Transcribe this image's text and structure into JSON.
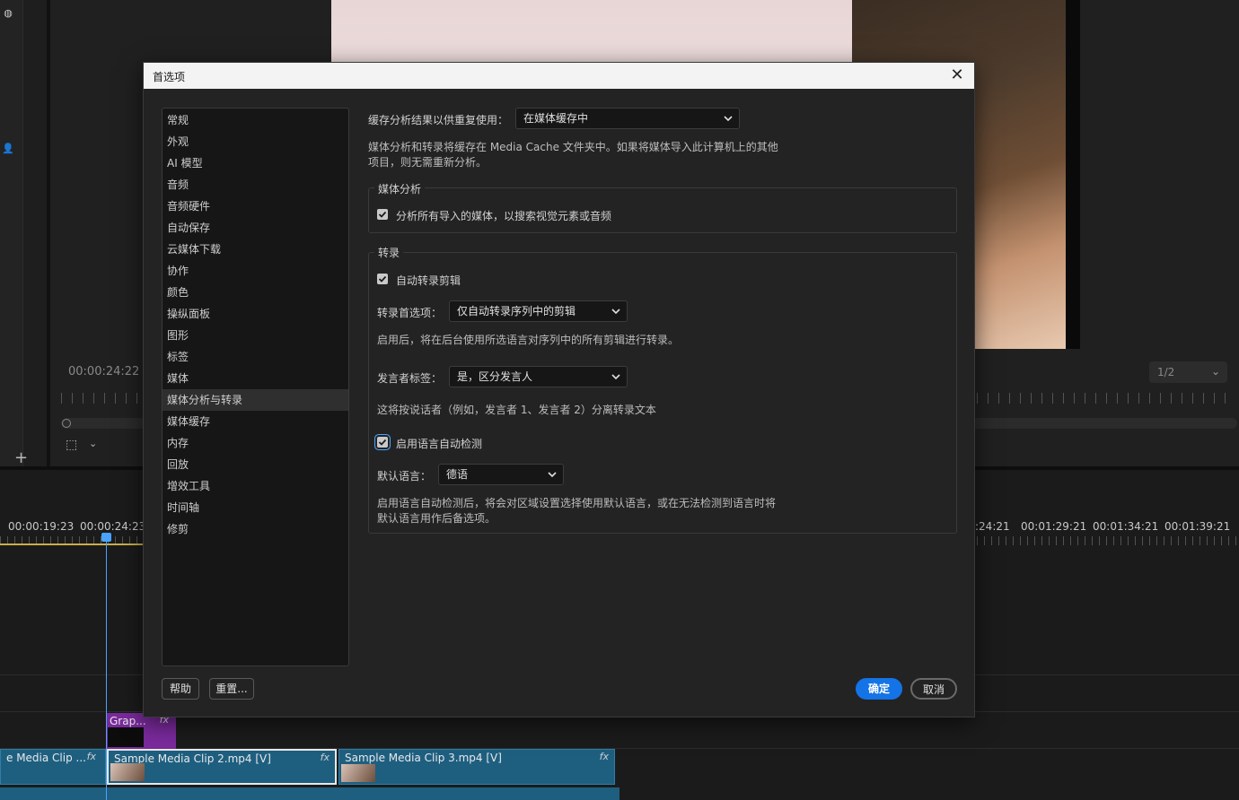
{
  "background": {
    "source_timecode": "00:00:24:22",
    "zoom_level": "1/2",
    "timeline_timecodes_left": [
      "00:00:19:23",
      "00:00:24:23"
    ],
    "timeline_timecodes_right": [
      ":24:21",
      "00:01:29:21",
      "00:01:34:21",
      "00:01:39:21"
    ],
    "clips": {
      "clip1": "e Media Clip ...",
      "clip2": "Sample Media Clip 2.mp4 [V]",
      "clip3": "Sample Media Clip 3.mp4 [V]",
      "graphic": "Grap...",
      "fx": "fx"
    }
  },
  "dialog": {
    "title": "首选项",
    "categories": [
      "常规",
      "外观",
      "AI 模型",
      "音频",
      "音频硬件",
      "自动保存",
      "云媒体下载",
      "协作",
      "颜色",
      "操纵面板",
      "图形",
      "标签",
      "媒体",
      "媒体分析与转录",
      "媒体缓存",
      "内存",
      "回放",
      "增效工具",
      "时间轴",
      "修剪"
    ],
    "active_category": "媒体分析与转录",
    "cache": {
      "label": "缓存分析结果以供重复使用：",
      "value": "在媒体缓存中",
      "description_line1": "媒体分析和转录将缓存在 Media Cache 文件夹中。如果将媒体导入此计算机上的其他",
      "description_line2": "项目，则无需重新分析。"
    },
    "media_analysis": {
      "title": "媒体分析",
      "analyze_label": "分析所有导入的媒体，以搜索视觉元素或音频",
      "analyze_checked": true
    },
    "transcription": {
      "title": "转录",
      "auto_label": "自动转录剪辑",
      "auto_checked": true,
      "pref_label": "转录首选项：",
      "pref_value": "仅自动转录序列中的剪辑",
      "pref_desc": "启用后，将在后台使用所选语言对序列中的所有剪辑进行转录。",
      "speaker_label": "发言者标签：",
      "speaker_value": "是，区分发言人",
      "speaker_desc": "这将按说话者（例如，发言者 1、发言者 2）分离转录文本",
      "lang_detect_label": "启用语言自动检测",
      "lang_detect_checked": true,
      "default_lang_label": "默认语言：",
      "default_lang_value": "德语",
      "lang_desc_line1": "启用语言自动检测后，将会对区域设置选择使用默认语言，或在无法检测到语言时将",
      "lang_desc_line2": "默认语言用作后备选项。"
    },
    "buttons": {
      "help": "帮助",
      "reset": "重置...",
      "ok": "确定",
      "cancel": "取消"
    }
  }
}
